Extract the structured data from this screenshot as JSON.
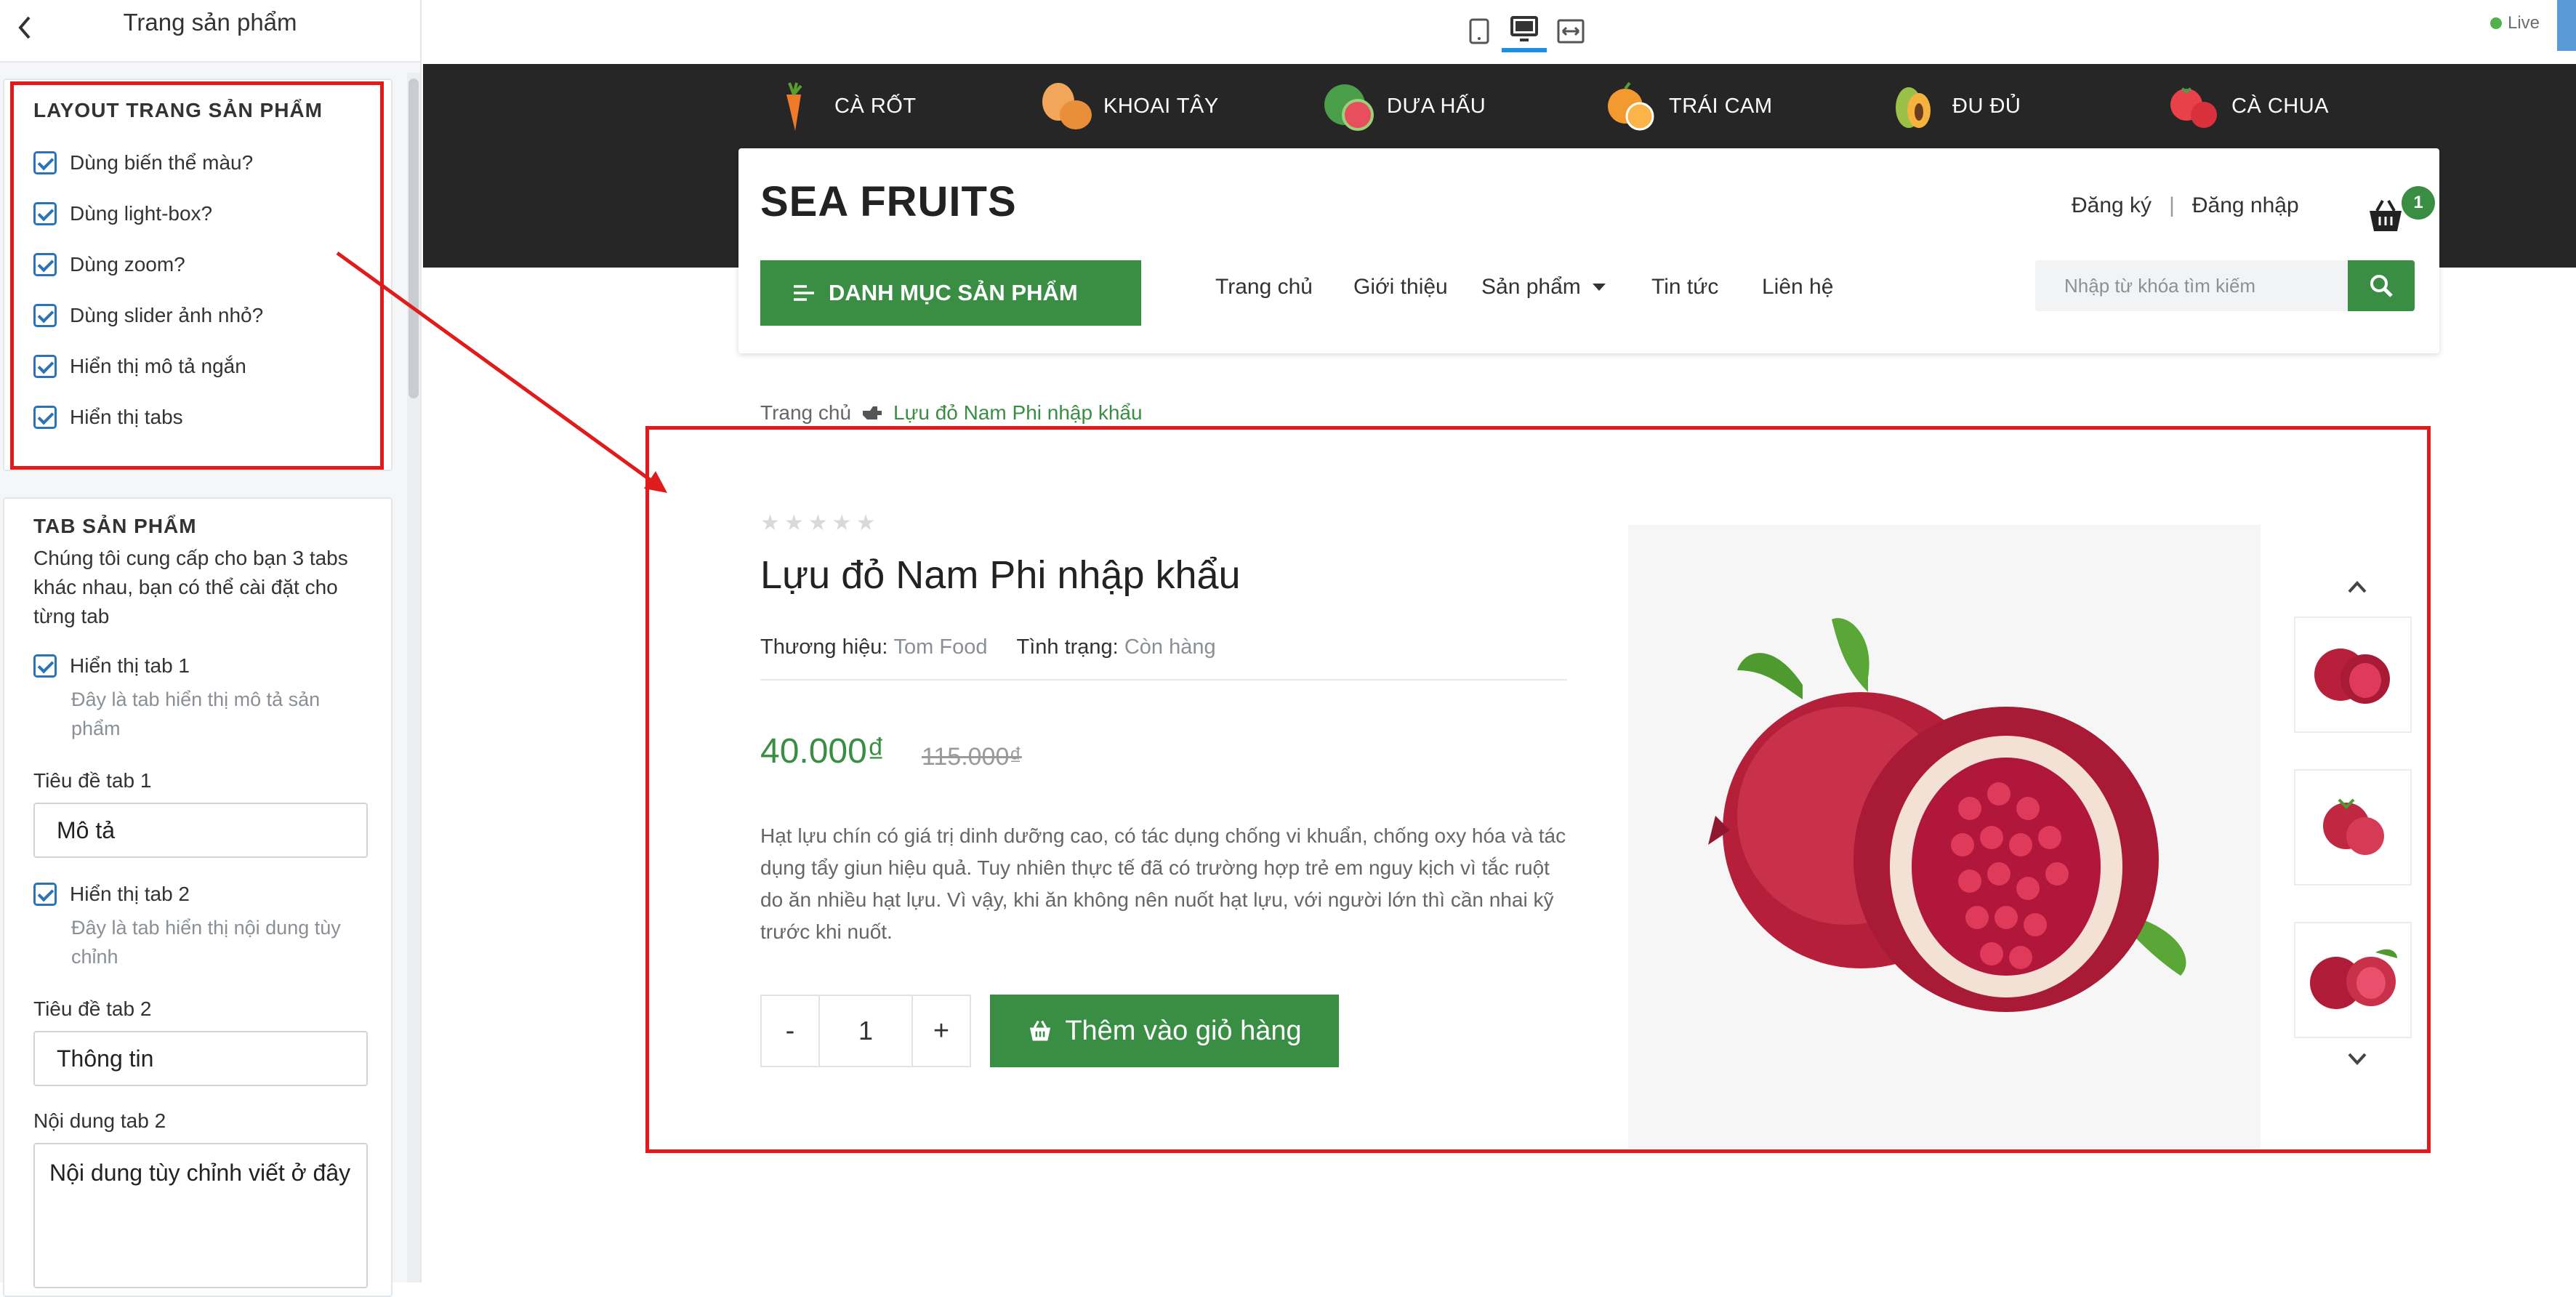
{
  "sidebar": {
    "title": "Trang sản phẩm",
    "layout_section": {
      "title": "LAYOUT TRANG SẢN PHẨM",
      "options": [
        {
          "label": "Dùng biến thể màu?",
          "checked": true
        },
        {
          "label": "Dùng light-box?",
          "checked": true
        },
        {
          "label": "Dùng zoom?",
          "checked": true
        },
        {
          "label": "Dùng slider ảnh nhỏ?",
          "checked": true
        },
        {
          "label": "Hiển thị mô tả ngắn",
          "checked": true
        },
        {
          "label": "Hiển thị tabs",
          "checked": true
        }
      ]
    },
    "tab_section": {
      "title": "TAB SẢN PHẨM",
      "description": "Chúng tôi cung cấp cho bạn 3 tabs khác nhau, bạn có thể cài đặt cho từng tab",
      "tab1_show": {
        "label": "Hiển thị tab 1",
        "help": "Đây là tab hiển thị mô tả sản phẩm",
        "checked": true
      },
      "tab1_title_label": "Tiêu đề tab 1",
      "tab1_title_value": "Mô tả",
      "tab2_show": {
        "label": "Hiển thị tab 2",
        "help": "Đây là tab hiển thị nội dung tùy chỉnh",
        "checked": true
      },
      "tab2_title_label": "Tiêu đề tab 2",
      "tab2_title_value": "Thông tin",
      "tab2_content_label": "Nội dung tab 2",
      "tab2_content_value": "Nội dung tùy chỉnh viết ở đây"
    }
  },
  "toolbar": {
    "devices": [
      "mobile-icon",
      "desktop-icon",
      "fullwidth-icon"
    ],
    "active_device": "desktop",
    "live_label": "Live"
  },
  "store": {
    "categories": [
      {
        "label": "CÀ RỐT",
        "icon": "carrot-icon"
      },
      {
        "label": "KHOAI TÂY",
        "icon": "potato-icon"
      },
      {
        "label": "DƯA HẤU",
        "icon": "watermelon-icon"
      },
      {
        "label": "TRÁI CAM",
        "icon": "orange-icon"
      },
      {
        "label": "ĐU ĐỦ",
        "icon": "papaya-icon"
      },
      {
        "label": "CÀ CHUA",
        "icon": "tomato-icon"
      }
    ],
    "logo": "SEA FRUITS",
    "register": "Đăng ký",
    "login": "Đăng nhập",
    "auth_separator": "|",
    "cart_count": "1",
    "category_button": "DANH MỤC SẢN PHẨM",
    "nav": [
      "Trang chủ",
      "Giới thiệu",
      "Sản phẩm",
      "Tin tức",
      "Liên hệ"
    ],
    "search_placeholder": "Nhập từ khóa tìm kiếm"
  },
  "breadcrumb": {
    "home": "Trang chủ",
    "current": "Lựu đỏ Nam Phi nhập khẩu"
  },
  "product": {
    "rating": 0,
    "title": "Lựu đỏ Nam Phi nhập khẩu",
    "brand_label": "Thương hiệu:",
    "brand": "Tom Food",
    "status_label": "Tình trạng:",
    "status": "Còn hàng",
    "price": "40.000₫",
    "old_price": "115.000₫",
    "description": "Hạt lựu chín có giá trị dinh dưỡng cao, có tác dụng chống vi khuẩn, chống oxy hóa và tác dụng tẩy giun hiệu quả. Tuy nhiên thực tế đã có trường hợp trẻ em nguy kịch vì tắc ruột do ăn nhiều hạt lựu. Vì vậy, khi ăn không nên nuốt hạt lựu, với người lớn thì cần nhai kỹ trước khi nuốt.",
    "qty_minus": "-",
    "qty_value": "1",
    "qty_plus": "+",
    "add_to_cart": "Thêm vào giỏ hàng"
  },
  "colors": {
    "brand_green": "#3a8e44",
    "annotation_red": "#e01b1b",
    "checkbox_blue": "#2b73b8",
    "dark_band": "#262626"
  }
}
